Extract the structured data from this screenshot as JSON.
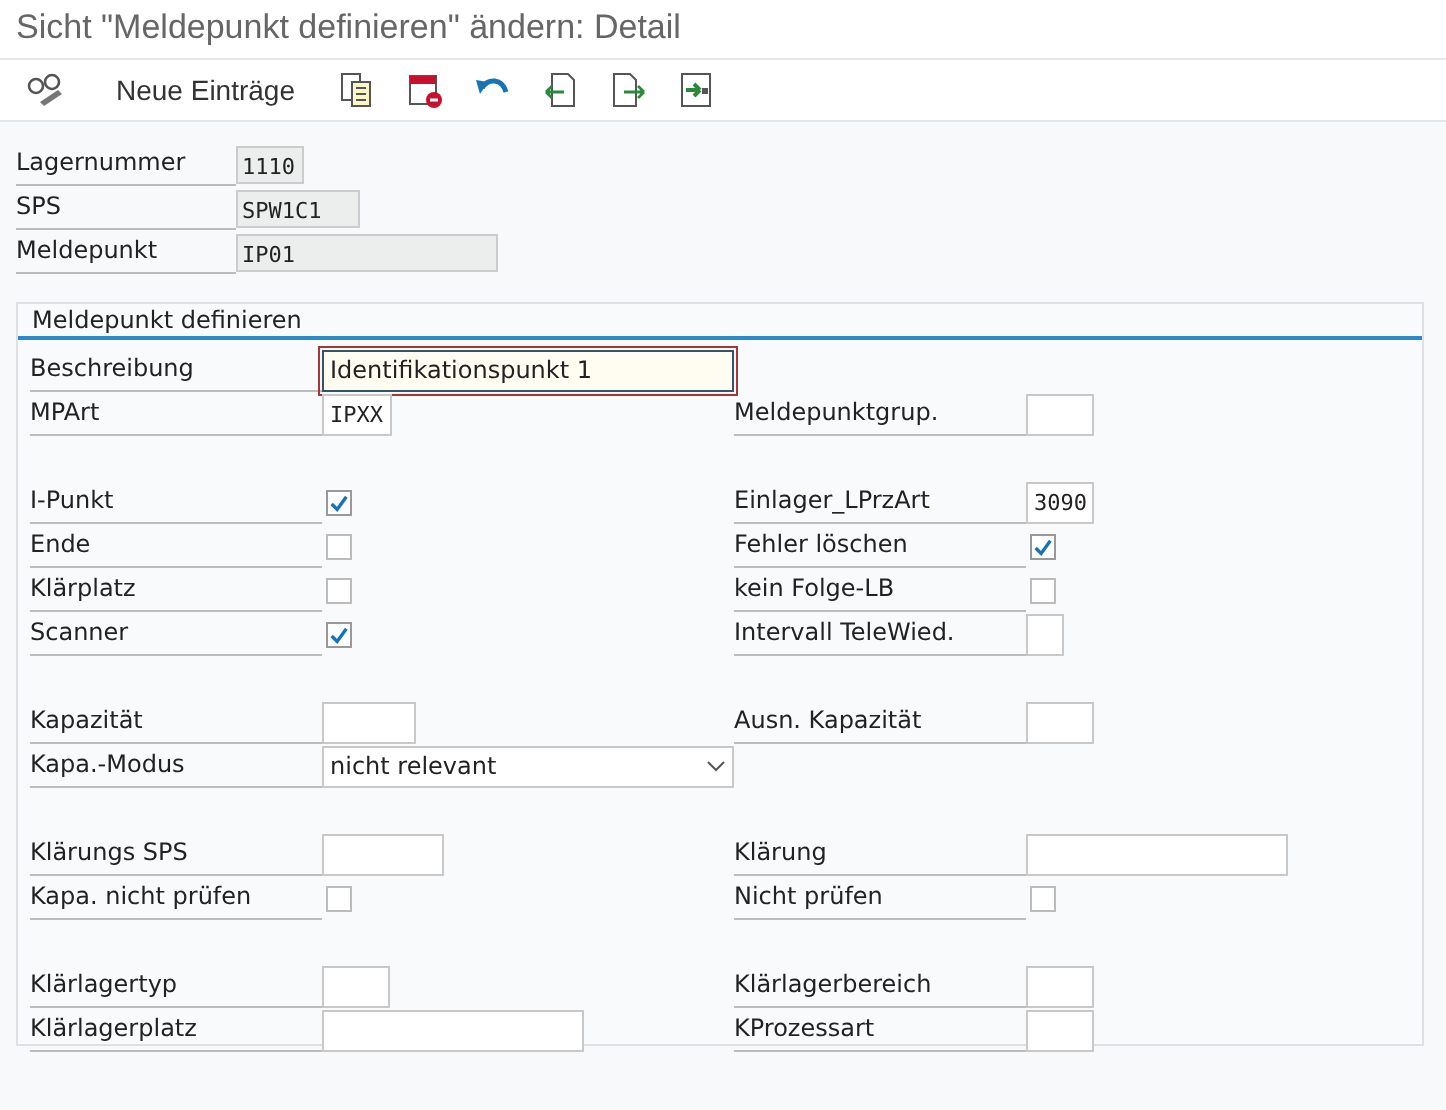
{
  "window": {
    "title": "Sicht \"Meldepunkt definieren\" ändern: Detail"
  },
  "toolbar": [
    {
      "kind": "glasses"
    },
    {
      "kind": "text",
      "label": "Neue Einträge"
    },
    {
      "kind": "copy"
    },
    {
      "kind": "delete"
    },
    {
      "kind": "undo"
    },
    {
      "kind": "prev"
    },
    {
      "kind": "next"
    },
    {
      "kind": "transfer"
    }
  ],
  "header": [
    {
      "label": "Lagernummer",
      "value": "1110"
    },
    {
      "label": "SPS",
      "value": "SPW1C1"
    },
    {
      "label": "Meldepunkt",
      "value": "IP01"
    }
  ],
  "group": {
    "title": "Meldepunkt definieren",
    "sections": [
      [
        {
          "left": {
            "kind": "text",
            "label": "Beschreibung",
            "value": "Identifikationspunkt 1",
            "focused": true
          }
        },
        {
          "left": {
            "kind": "code",
            "label": "MPArt",
            "value": "IPXX"
          },
          "right": {
            "kind": "code",
            "label": "Meldepunktgrup."
          }
        }
      ],
      [
        {
          "left": {
            "kind": "check",
            "label": "I-Punkt",
            "checked": true
          },
          "right": {
            "kind": "code",
            "label": "Einlager_LPrzArt",
            "value": "3090"
          }
        },
        {
          "left": {
            "kind": "check",
            "label": "Ende",
            "checked": false
          },
          "right": {
            "kind": "check",
            "label": "Fehler löschen",
            "checked": true
          }
        },
        {
          "left": {
            "kind": "check",
            "label": "Klärplatz",
            "checked": false
          },
          "right": {
            "kind": "check",
            "label": "kein Folge-LB",
            "checked": false
          }
        },
        {
          "left": {
            "kind": "check",
            "label": "Scanner",
            "checked": true
          },
          "right": {
            "kind": "code",
            "label": "Intervall TeleWied."
          }
        }
      ],
      [
        {
          "left": {
            "kind": "code",
            "label": "Kapazität"
          },
          "right": {
            "kind": "code",
            "label": "Ausn. Kapazität"
          }
        },
        {
          "left": {
            "kind": "select",
            "label": "Kapa.-Modus",
            "value": "nicht relevant"
          }
        }
      ],
      [
        {
          "left": {
            "kind": "code",
            "label": "Klärungs SPS"
          },
          "right": {
            "kind": "code",
            "label": "Klärung"
          }
        },
        {
          "left": {
            "kind": "check",
            "label": "Kapa. nicht prüfen",
            "checked": false
          },
          "right": {
            "kind": "check",
            "label": "Nicht prüfen",
            "checked": false
          }
        }
      ],
      [
        {
          "left": {
            "kind": "code",
            "label": "Klärlagertyp"
          },
          "right": {
            "kind": "code",
            "label": "Klärlagerbereich"
          }
        },
        {
          "left": {
            "kind": "code",
            "label": "Klärlagerplatz"
          },
          "right": {
            "kind": "code",
            "label": "KProzessart"
          }
        }
      ]
    ]
  }
}
